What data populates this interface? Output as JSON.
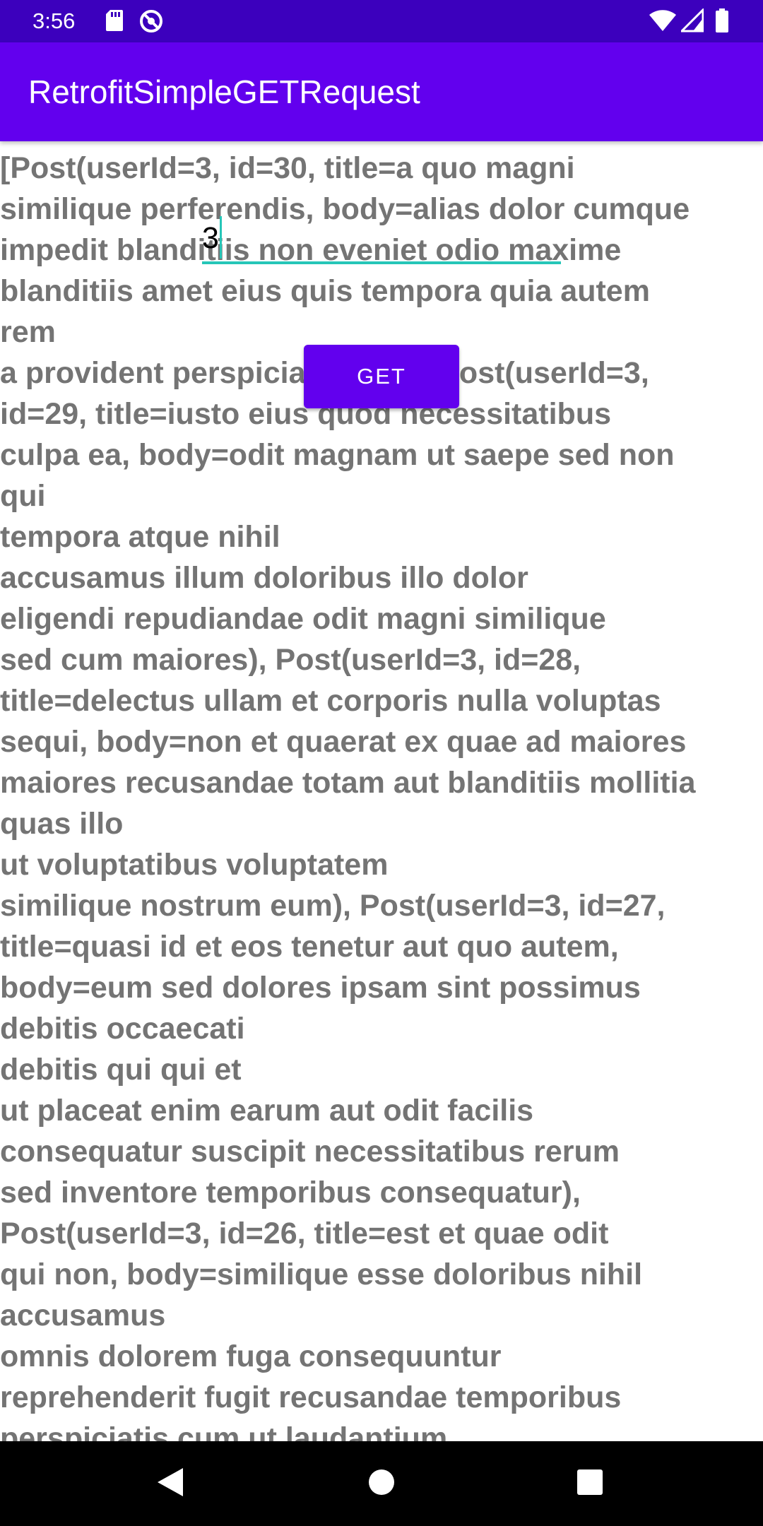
{
  "status_bar": {
    "time": "3:56",
    "left_icons": [
      "sd-card-icon",
      "no-disturb-icon"
    ],
    "right_icons": [
      "wifi-icon",
      "signal-icon",
      "battery-icon"
    ]
  },
  "app_bar": {
    "title": "RetrofitSimpleGETRequest",
    "color": "#6200ee"
  },
  "input": {
    "value": "3"
  },
  "button": {
    "label": "GET"
  },
  "response_text": "[Post(userId=3, id=30, title=a quo magni\nsimilique perferendis, body=alias dolor cumque\nimpedit blanditiis non eveniet odio maxime\nblanditiis amet eius quis tempora quia autem\nrem\na provident perspiciatis quia), Post(userId=3,\nid=29, title=iusto eius quod necessitatibus\nculpa ea, body=odit magnam ut saepe sed non\nqui\ntempora atque nihil\naccusamus illum doloribus illo dolor\neligendi repudiandae odit magni similique\nsed cum maiores), Post(userId=3, id=28,\ntitle=delectus ullam et corporis nulla voluptas\nsequi, body=non et quaerat ex quae ad maiores\nmaiores recusandae totam aut blanditiis mollitia\nquas illo\nut voluptatibus voluptatem\nsimilique nostrum eum), Post(userId=3, id=27,\ntitle=quasi id et eos tenetur aut quo autem,\nbody=eum sed dolores ipsam sint possimus\ndebitis occaecati\ndebitis qui qui et\nut placeat enim earum aut odit facilis\nconsequatur suscipit necessitatibus rerum\nsed inventore temporibus consequatur),\nPost(userId=3, id=26, title=est et quae odit\nqui non, body=similique esse doloribus nihil\naccusamus\nomnis dolorem fuga consequuntur\nreprehenderit fugit recusandae temporibus\nperspiciatis cum ut laudantium",
  "nav_bar": {
    "buttons": [
      "back-icon",
      "home-icon",
      "recents-icon"
    ]
  }
}
